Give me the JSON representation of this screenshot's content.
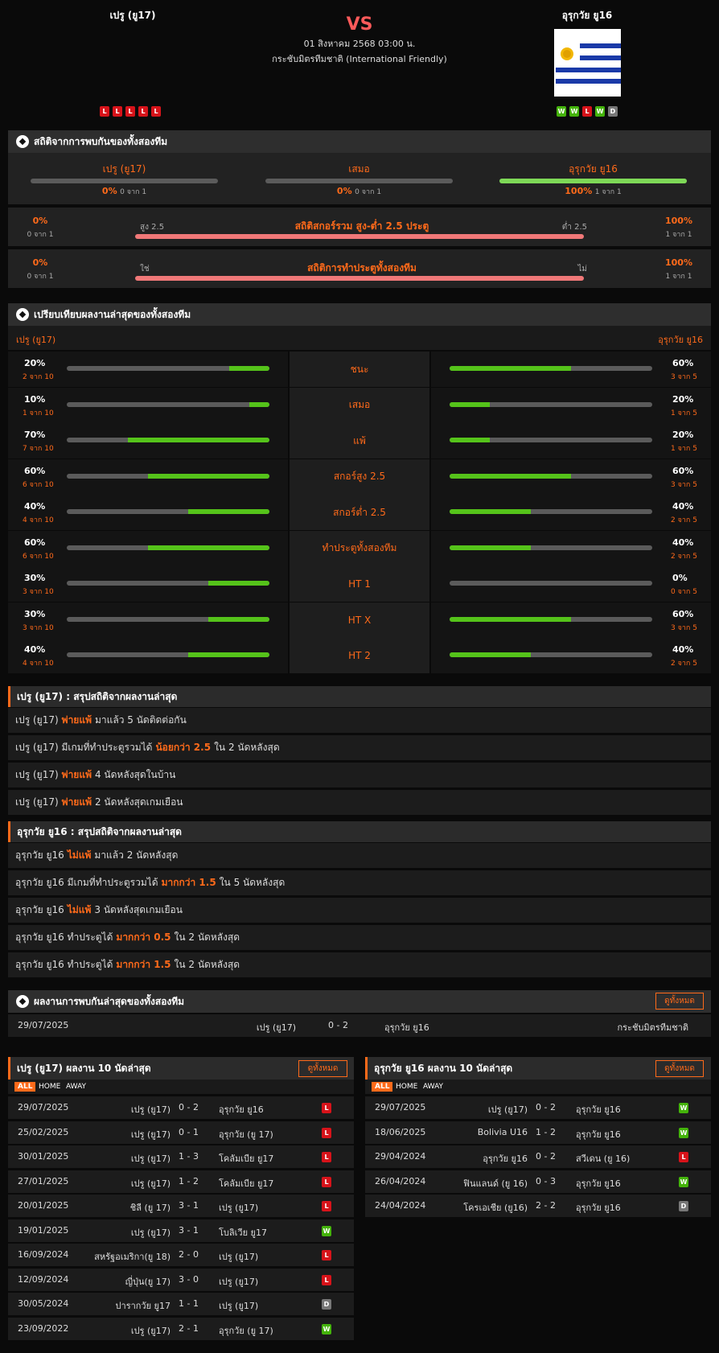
{
  "header": {
    "home": "เปรู (ยู17)",
    "away": "อุรุกวัย ยู16",
    "vs": "VS",
    "date": "01 สิงหาคม 2568 03:00 น.",
    "competition": "กระชับมิตรทีมชาติ (International Friendly)",
    "home_form": [
      "L",
      "L",
      "L",
      "L",
      "L"
    ],
    "away_form": [
      "W",
      "W",
      "L",
      "W",
      "D"
    ]
  },
  "h2h": {
    "title": "สถิติจากการพบกันของทั้งสองทีม",
    "home": {
      "label": "เปรู (ยู17)",
      "pct": "0%",
      "sub": "0 จาก 1",
      "fill": 0
    },
    "draw": {
      "label": "เสมอ",
      "pct": "0%",
      "sub": "0 จาก 1",
      "fill": 0
    },
    "away": {
      "label": "อุรุกวัย ยู16",
      "pct": "100%",
      "sub": "1 จาก 1",
      "fill": 1
    },
    "ou": {
      "title": "สถิติสกอร์รวม สูง-ต่ำ 2.5 ประตู",
      "left": "สูง 2.5",
      "right": "ต่ำ 2.5",
      "lpct": "0%",
      "lsub": "0 จาก 1",
      "rpct": "100%",
      "rsub": "1 จาก 1"
    },
    "btts": {
      "title": "สถิติการทำประตูทั้งสองทีม",
      "left": "ใช่",
      "right": "ไม่",
      "lpct": "0%",
      "lsub": "0 จาก 1",
      "rpct": "100%",
      "rsub": "1 จาก 1"
    }
  },
  "compare": {
    "title": "เปรียบเทียบผลงานล่าสุดของทั้งสองทีม",
    "home": "เปรู (ยู17)",
    "away": "อุรุกวัย ยู16",
    "rows": [
      {
        "label": "ชนะ",
        "lp": "20%",
        "ls": "2 จาก 10",
        "lf": 0.2,
        "rp": "60%",
        "rs": "3 จาก 5",
        "rf": 0.6
      },
      {
        "label": "เสมอ",
        "lp": "10%",
        "ls": "1 จาก 10",
        "lf": 0.1,
        "rp": "20%",
        "rs": "1 จาก 5",
        "rf": 0.2
      },
      {
        "label": "แพ้",
        "lp": "70%",
        "ls": "7 จาก 10",
        "lf": 0.7,
        "rp": "20%",
        "rs": "1 จาก 5",
        "rf": 0.2
      },
      {
        "label": "สกอร์สูง 2.5",
        "lp": "60%",
        "ls": "6 จาก 10",
        "lf": 0.6,
        "rp": "60%",
        "rs": "3 จาก 5",
        "rf": 0.6
      },
      {
        "label": "สกอร์ต่ำ 2.5",
        "lp": "40%",
        "ls": "4 จาก 10",
        "lf": 0.4,
        "rp": "40%",
        "rs": "2 จาก 5",
        "rf": 0.4
      },
      {
        "label": "ทำประตูทั้งสองทีม",
        "lp": "60%",
        "ls": "6 จาก 10",
        "lf": 0.6,
        "rp": "40%",
        "rs": "2 จาก 5",
        "rf": 0.4
      },
      {
        "label": "HT 1",
        "lp": "30%",
        "ls": "3 จาก 10",
        "lf": 0.3,
        "rp": "0%",
        "rs": "0 จาก 5",
        "rf": 0
      },
      {
        "label": "HT X",
        "lp": "30%",
        "ls": "3 จาก 10",
        "lf": 0.3,
        "rp": "60%",
        "rs": "3 จาก 5",
        "rf": 0.6
      },
      {
        "label": "HT 2",
        "lp": "40%",
        "ls": "4 จาก 10",
        "lf": 0.4,
        "rp": "40%",
        "rs": "2 จาก 5",
        "rf": 0.4
      }
    ]
  },
  "home_summary": {
    "title": "เปรู (ยู17) : สรุปสถิติจากผลงานล่าสุด",
    "rows": [
      {
        "a": "เปรู (ยู17)",
        "h": "พ่ายแพ้",
        "b": "มาแล้ว 5 นัดติดต่อกัน"
      },
      {
        "a": "เปรู (ยู17) มีเกมที่ทำประตูรวมได้",
        "h": "น้อยกว่า 2.5",
        "b": "ใน 2 นัดหลังสุด"
      },
      {
        "a": "เปรู (ยู17)",
        "h": "พ่ายแพ้",
        "b": "4 นัดหลังสุดในบ้าน"
      },
      {
        "a": "เปรู (ยู17)",
        "h": "พ่ายแพ้",
        "b": "2 นัดหลังสุดเกมเยือน"
      }
    ]
  },
  "away_summary": {
    "title": "อุรุกวัย ยู16 : สรุปสถิติจากผลงานล่าสุด",
    "rows": [
      {
        "a": "อุรุกวัย ยู16",
        "h": "ไม่แพ้",
        "b": "มาแล้ว 2 นัดหลังสุด"
      },
      {
        "a": "อุรุกวัย ยู16 มีเกมที่ทำประตูรวมได้",
        "h": "มากกว่า 1.5",
        "b": "ใน 5 นัดหลังสุด"
      },
      {
        "a": "อุรุกวัย ยู16",
        "h": "ไม่แพ้",
        "b": "3 นัดหลังสุดเกมเยือน"
      },
      {
        "a": "อุรุกวัย ยู16 ทำประตูได้",
        "h": "มากกว่า 0.5",
        "b": "ใน 2 นัดหลังสุด"
      },
      {
        "a": "อุรุกวัย ยู16 ทำประตูได้",
        "h": "มากกว่า 1.5",
        "b": "ใน 2 นัดหลังสุด"
      }
    ]
  },
  "last_h2h": {
    "title": "ผลงานการพบกันล่าสุดของทั้งสองทีม",
    "view_all": "ดูทั้งหมด",
    "row": {
      "date": "29/07/2025",
      "home": "เปรู (ยู17)",
      "score": "0 - 2",
      "away": "อุรุกวัย ยู16",
      "comp": "กระชับมิตรทีมชาติ"
    }
  },
  "home_last": {
    "title": "เปรู (ยู17) ผลงาน 10 นัดล่าสุด",
    "view_all": "ดูทั้งหมด",
    "tabs": [
      "ALL",
      "HOME",
      "AWAY"
    ],
    "rows": [
      {
        "date": "29/07/2025",
        "home": "เปรู (ยู17)",
        "score": "0 - 2",
        "away": "อุรุกวัย ยู16",
        "r": "L"
      },
      {
        "date": "25/02/2025",
        "home": "เปรู (ยู17)",
        "score": "0 - 1",
        "away": "อุรุกวัย (ยู 17)",
        "r": "L"
      },
      {
        "date": "30/01/2025",
        "home": "เปรู (ยู17)",
        "score": "1 - 3",
        "away": "โคลัมเบีย ยู17",
        "r": "L"
      },
      {
        "date": "27/01/2025",
        "home": "เปรู (ยู17)",
        "score": "1 - 2",
        "away": "โคลัมเบีย ยู17",
        "r": "L"
      },
      {
        "date": "20/01/2025",
        "home": "ชิลี (ยู 17)",
        "score": "3 - 1",
        "away": "เปรู (ยู17)",
        "r": "L"
      },
      {
        "date": "19/01/2025",
        "home": "เปรู (ยู17)",
        "score": "3 - 1",
        "away": "โบลิเวีย ยู17",
        "r": "W"
      },
      {
        "date": "16/09/2024",
        "home": "สหรัฐอเมริกา(ยู 18)",
        "score": "2 - 0",
        "away": "เปรู (ยู17)",
        "r": "L"
      },
      {
        "date": "12/09/2024",
        "home": "ญี่ปุ่น(ยู 17)",
        "score": "3 - 0",
        "away": "เปรู (ยู17)",
        "r": "L"
      },
      {
        "date": "30/05/2024",
        "home": "ปารากวัย ยู17",
        "score": "1 - 1",
        "away": "เปรู (ยู17)",
        "r": "D"
      },
      {
        "date": "23/09/2022",
        "home": "เปรู (ยู17)",
        "score": "2 - 1",
        "away": "อุรุกวัย (ยู 17)",
        "r": "W"
      }
    ]
  },
  "away_last": {
    "title": "อุรุกวัย ยู16 ผลงาน 10 นัดล่าสุด",
    "view_all": "ดูทั้งหมด",
    "tabs": [
      "ALL",
      "HOME",
      "AWAY"
    ],
    "rows": [
      {
        "date": "29/07/2025",
        "home": "เปรู (ยู17)",
        "score": "0 - 2",
        "away": "อุรุกวัย ยู16",
        "r": "W"
      },
      {
        "date": "18/06/2025",
        "home": "Bolivia U16",
        "score": "1 - 2",
        "away": "อุรุกวัย ยู16",
        "r": "W"
      },
      {
        "date": "29/04/2024",
        "home": "อุรุกวัย ยู16",
        "score": "0 - 2",
        "away": "สวีเดน (ยู 16)",
        "r": "L"
      },
      {
        "date": "26/04/2024",
        "home": "ฟินแลนด์ (ยู 16)",
        "score": "0 - 3",
        "away": "อุรุกวัย ยู16",
        "r": "W"
      },
      {
        "date": "24/04/2024",
        "home": "โครเอเชีย (ยู16)",
        "score": "2 - 2",
        "away": "อุรุกวัย ยู16",
        "r": "D"
      }
    ]
  }
}
